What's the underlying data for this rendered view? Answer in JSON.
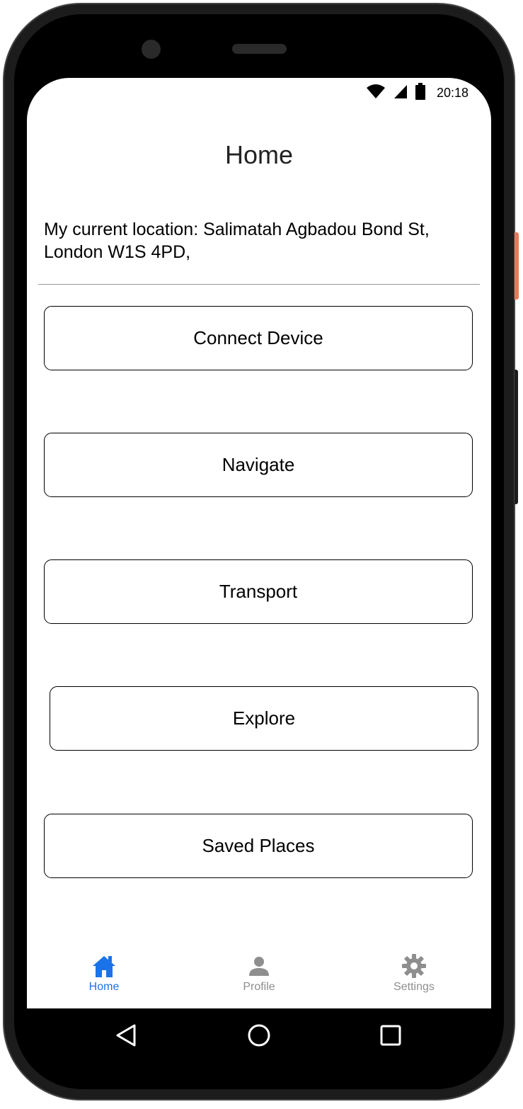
{
  "status_bar": {
    "time": "20:18",
    "icons": [
      "wifi-icon",
      "cellular-signal-icon",
      "battery-icon"
    ]
  },
  "header": {
    "title": "Home"
  },
  "location": {
    "text": "My current location: Salimatah Agbadou Bond St, London W1S 4PD,"
  },
  "menu": {
    "connect_device": "Connect Device",
    "navigate": "Navigate",
    "transport": "Transport",
    "explore": "Explore",
    "saved_places": "Saved Places"
  },
  "tab_bar": {
    "active_color": "#1a73e8",
    "inactive_color": "#8e8e8e",
    "home": "Home",
    "profile": "Profile",
    "settings": "Settings",
    "active_tab": "Home"
  },
  "system_nav": {
    "icons": [
      "back-icon",
      "home-circle-icon",
      "recents-icon"
    ]
  }
}
